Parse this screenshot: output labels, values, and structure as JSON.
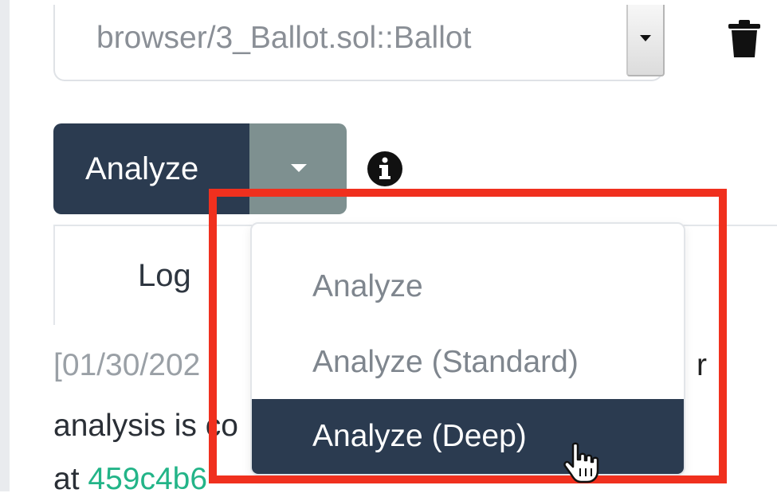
{
  "contract_selector": {
    "value": "browser/3_Ballot.sol::Ballot"
  },
  "icons": {
    "trash": "trash-icon",
    "info": "info-icon",
    "dropdown_arrow": "chevron-down-icon",
    "cursor": "hand-pointer-icon"
  },
  "analyze_button": {
    "label": "Analyze"
  },
  "tabs": {
    "log_label": "Log"
  },
  "log": {
    "line1_start": "[01/30/202",
    "line1_end": "r",
    "line2": "analysis is co",
    "line3_prefix": "at ",
    "line3_hash": "459c4b6"
  },
  "dropdown": {
    "items": [
      {
        "label": "Analyze"
      },
      {
        "label": "Analyze (Standard)"
      },
      {
        "label": "Analyze (Deep)",
        "selected": true
      }
    ]
  },
  "colors": {
    "primary": "#2b3b50",
    "toggle": "#7e9090",
    "highlight": "#f0301e",
    "hash": "#23b488"
  }
}
